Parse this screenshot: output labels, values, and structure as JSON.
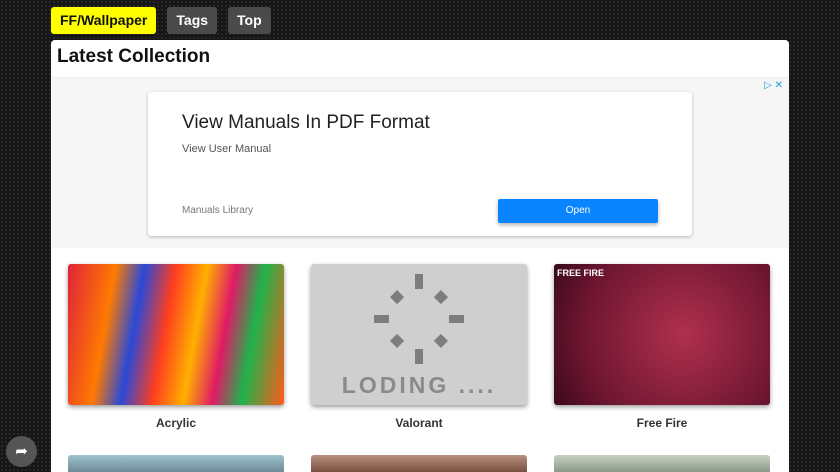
{
  "nav": {
    "brand": "FF/Wallpaper",
    "tags": "Tags",
    "top": "Top"
  },
  "page_title": "Latest Collection",
  "ad": {
    "headline": "View Manuals In PDF Format",
    "subtitle": "View User Manual",
    "advertiser": "Manuals Library",
    "button": "Open"
  },
  "loading_text": "LODING ....",
  "ff_logo_text": "FREE FIRE",
  "wallpapers": [
    {
      "title": "Acrylic"
    },
    {
      "title": "Valorant"
    },
    {
      "title": "Free Fire"
    }
  ]
}
